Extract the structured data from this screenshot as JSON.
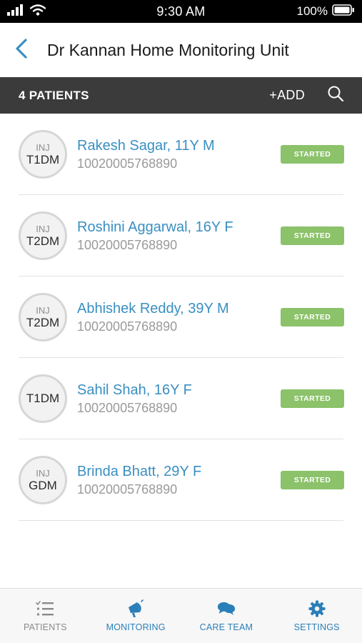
{
  "status_bar": {
    "time": "9:30 AM",
    "battery": "100%",
    "icons": [
      "signal-icon",
      "wifi-icon",
      "battery-icon"
    ]
  },
  "header": {
    "title": "Dr Kannan Home Monitoring Unit",
    "back_icon": "chevron-left-icon"
  },
  "toolbar": {
    "count_label": "4 PATIENTS",
    "add_label": "+ADD",
    "search_icon": "search-icon"
  },
  "patients": [
    {
      "avatar_top": "INJ",
      "avatar_bottom": "T1DM",
      "name": "Rakesh Sagar, 11Y M",
      "id": "10020005768890",
      "status": "STARTED"
    },
    {
      "avatar_top": "INJ",
      "avatar_bottom": "T2DM",
      "name": "Roshini Aggarwal, 16Y F",
      "id": "10020005768890",
      "status": "STARTED"
    },
    {
      "avatar_top": "INJ",
      "avatar_bottom": "T2DM",
      "name": "Abhishek Reddy, 39Y M",
      "id": "10020005768890",
      "status": "STARTED"
    },
    {
      "avatar_top": "",
      "avatar_bottom": "T1DM",
      "name": "Sahil Shah, 16Y F",
      "id": "10020005768890",
      "status": "STARTED"
    },
    {
      "avatar_top": "INJ",
      "avatar_bottom": "GDM",
      "name": "Brinda Bhatt, 29Y F",
      "id": "10020005768890",
      "status": "STARTED"
    }
  ],
  "bottom_nav": [
    {
      "label": "PATIENTS",
      "icon": "checklist-icon",
      "active": false
    },
    {
      "label": "MONITORING",
      "icon": "megaphone-icon",
      "active": true
    },
    {
      "label": "CARE TEAM",
      "icon": "chat-bubbles-icon",
      "active": true
    },
    {
      "label": "SETTINGS",
      "icon": "gear-icon",
      "active": true
    }
  ],
  "colors": {
    "accent": "#3a8fc2",
    "toolbar_bg": "#3b3b3b",
    "status_green": "#8bc26a",
    "nav_active": "#2b7fb8",
    "nav_inactive": "#8a8a8a"
  }
}
